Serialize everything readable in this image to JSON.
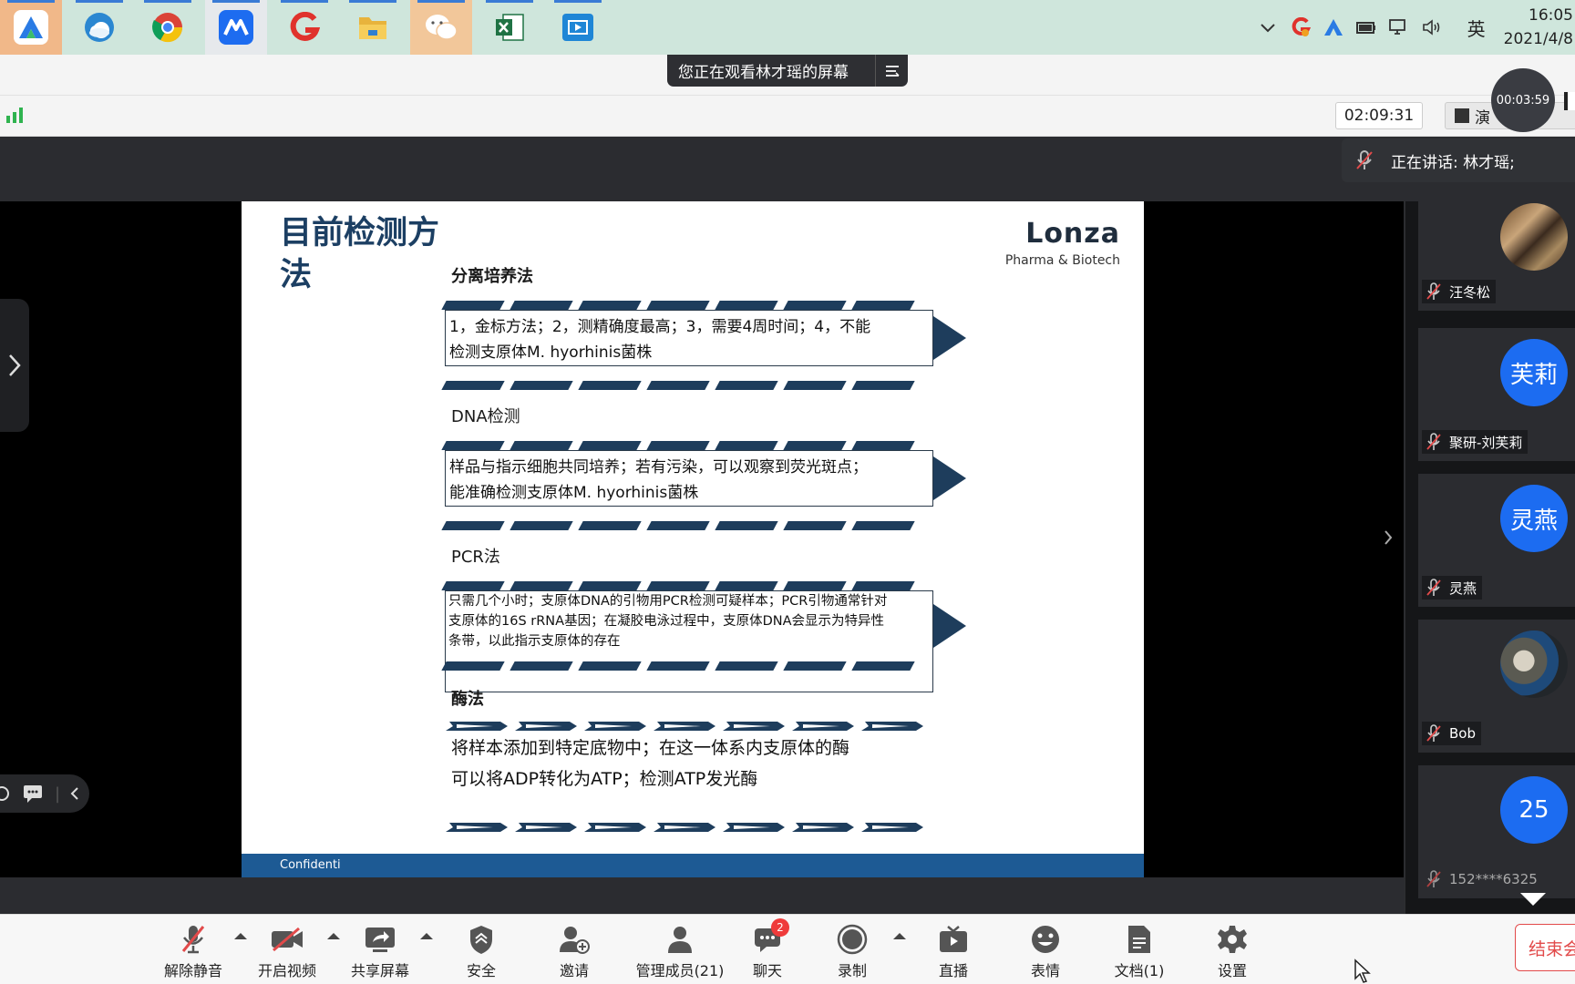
{
  "taskbar": {
    "apps": [
      {
        "name": "ai-app",
        "icon": "A",
        "color": "#2a7be4"
      },
      {
        "name": "edge-browser",
        "icon": "e",
        "color": "#2b87d1"
      },
      {
        "name": "chrome",
        "icon": "c",
        "color": "#db4437"
      },
      {
        "name": "tencent-meeting",
        "icon": "M",
        "color": "#1d6cf0"
      },
      {
        "name": "red-app",
        "icon": "G",
        "color": "#e0322c"
      },
      {
        "name": "file-explorer",
        "icon": "F",
        "color": "#e8b33c"
      },
      {
        "name": "wechat",
        "icon": "W",
        "color": "#ffffff"
      },
      {
        "name": "excel",
        "icon": "X",
        "color": "#1f7244"
      },
      {
        "name": "video-app",
        "icon": "V",
        "color": "#1f86d6"
      }
    ],
    "ime": "英",
    "time": "16:05",
    "date": "2021/4/8"
  },
  "sharing_notice": "您正在观看林才瑶的屏幕",
  "meeting": {
    "duration": "02:09:31",
    "view_label": "演",
    "recording_time": "00:03:59",
    "speaking": "正在讲话: 林才瑶;"
  },
  "slide": {
    "title": "目前检测方法",
    "logo_name": "Lonza",
    "logo_sub": "Pharma & Biotech",
    "footer": "Confidenti",
    "sections": [
      {
        "title": "分离培养法",
        "lines": [
          "1，金标方法；2，测精确度最高；3，需要4周时间；4，不能",
          "检测支原体M. hyorhinis菌株"
        ]
      },
      {
        "title": "DNA检测",
        "lines": [
          "样品与指示细胞共同培养；若有污染，可以观察到荧光斑点；",
          "能准确检测支原体M. hyorhinis菌株"
        ]
      },
      {
        "title": "PCR法",
        "lines": [
          "只需几个小时；支原体DNA的引物用PCR检测可疑样本；PCR引物通常针对",
          "支原体的16S rRNA基因；在凝胶电泳过程中，支原体DNA会显示为特异性",
          "条带，以此指示支原体的存在"
        ]
      },
      {
        "title": "酶法",
        "lines": [
          "将样本添加到特定底物中；在这一体系内支原体的酶",
          "可以将ADP转化为ATP；检测ATP发光酶"
        ]
      }
    ]
  },
  "participants": [
    {
      "name": "汪冬松",
      "avatar_text": "",
      "avatar_type": "photo1"
    },
    {
      "name": "聚研-刘芙莉",
      "avatar_text": "芙莉",
      "avatar_type": "blue"
    },
    {
      "name": "灵燕",
      "avatar_text": "灵燕",
      "avatar_type": "blue"
    },
    {
      "name": "Bob",
      "avatar_text": "",
      "avatar_type": "photo2"
    },
    {
      "name": "152****6325",
      "avatar_text": "25",
      "avatar_type": "blue"
    }
  ],
  "toolbar": {
    "unmute": "解除静音",
    "video": "开启视频",
    "share": "共享屏幕",
    "security": "安全",
    "invite": "邀请",
    "members": "管理成员(21)",
    "chat": "聊天",
    "chat_badge": "2",
    "record": "录制",
    "live": "直播",
    "emoji": "表情",
    "docs": "文档(1)",
    "settings": "设置",
    "end": "结束会"
  }
}
